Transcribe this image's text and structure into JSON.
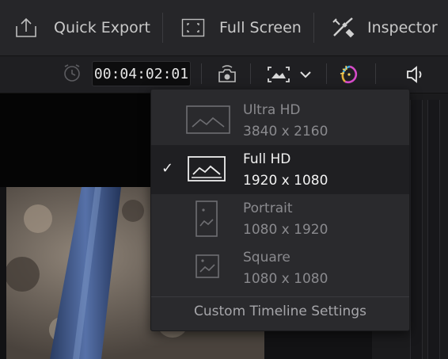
{
  "topbar": {
    "quick_export_label": "Quick Export",
    "full_screen_label": "Full Screen",
    "inspector_label": "Inspector"
  },
  "toolbar": {
    "timecode": "00:04:02:01"
  },
  "resolution_menu": {
    "items": [
      {
        "name": "Ultra HD",
        "size": "3840 x 2160",
        "icon": "landscape-frame-icon",
        "selected": false
      },
      {
        "name": "Full HD",
        "size": "1920 x 1080",
        "icon": "landscape-frame-icon",
        "selected": true
      },
      {
        "name": "Portrait",
        "size": "1080 x 1920",
        "icon": "portrait-frame-icon",
        "selected": false
      },
      {
        "name": "Square",
        "size": "1080 x 1080",
        "icon": "square-frame-icon",
        "selected": false
      }
    ],
    "footer_label": "Custom Timeline Settings"
  },
  "colors": {
    "background": "#1e1e20",
    "menu_background": "#2a2a2d",
    "selected_row": "#1f1f22",
    "accent_magenta": "#d64cc9"
  }
}
